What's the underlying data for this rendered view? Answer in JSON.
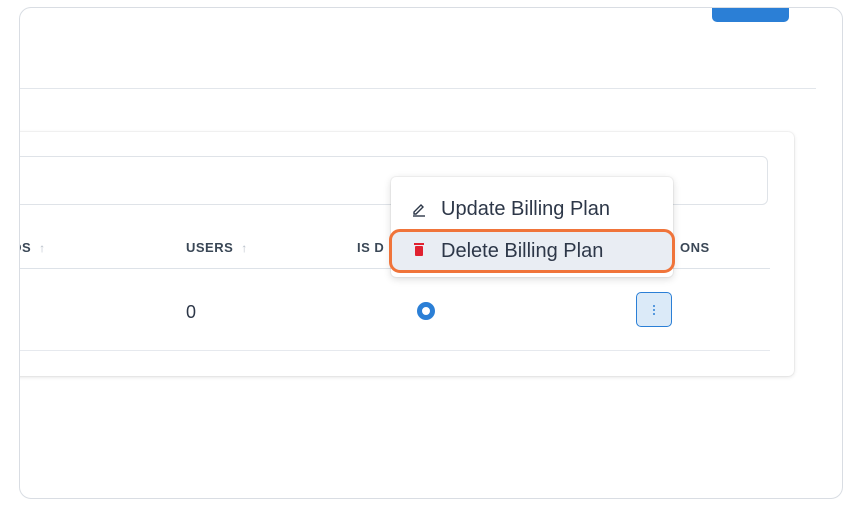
{
  "table": {
    "columns": [
      {
        "label": "IDS",
        "sort_icon": "↑"
      },
      {
        "label": "USERS",
        "sort_icon": "↑"
      },
      {
        "label": "IS D",
        "sort_icon": ""
      },
      {
        "label": "ONS",
        "sort_icon": ""
      }
    ],
    "rows": [
      {
        "users": "0",
        "is_default": true
      }
    ]
  },
  "dropdown": {
    "items": [
      {
        "label": "Update Billing Plan",
        "icon": "pencil-icon"
      },
      {
        "label": "Delete Billing Plan",
        "icon": "trash-icon",
        "highlighted": true
      }
    ]
  },
  "colors": {
    "accent": "#2b7fd6",
    "highlight_border": "#f0743a",
    "delete_icon": "#e0212f"
  }
}
